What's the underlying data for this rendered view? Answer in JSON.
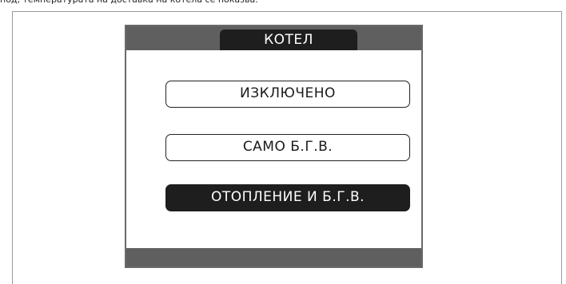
{
  "caption": {
    "text": "под, температурата на доставка на котела се показва."
  },
  "screen": {
    "title": "КОТЕЛ",
    "options": [
      {
        "label": "ИЗКЛЮЧЕНО",
        "selected": false
      },
      {
        "label": "САМО Б.Г.В.",
        "selected": false
      },
      {
        "label": "ОТОПЛЕНИЕ И Б.Г.В.",
        "selected": true
      }
    ]
  },
  "colors": {
    "bar": "#5f5f5f",
    "selected_bg": "#1e1e1e",
    "selected_text": "#ffffff",
    "text": "#1a1a1a"
  }
}
